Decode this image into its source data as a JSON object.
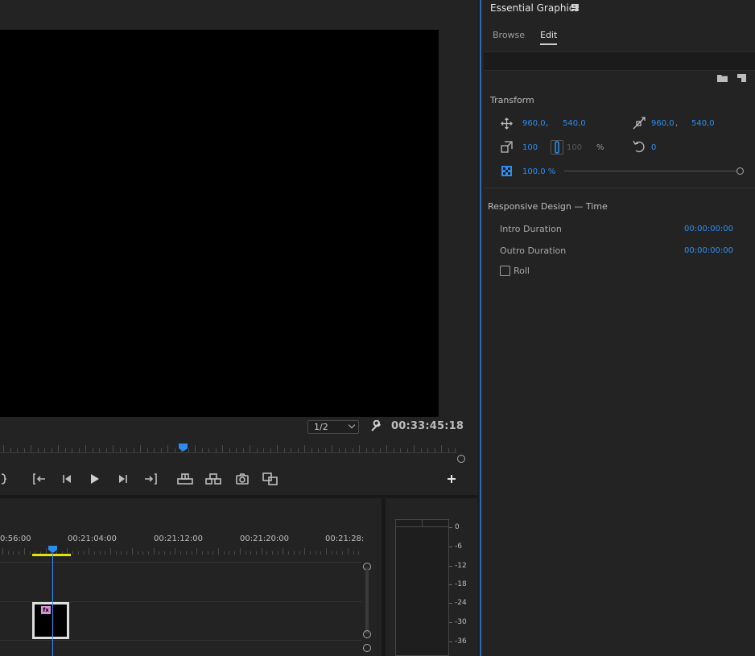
{
  "program_monitor": {
    "resolution": "1/2",
    "timecode": "00:33:45:18"
  },
  "timeline": {
    "ruler_labels": [
      "0:56:00",
      "00:21:04:00",
      "00:21:12:00",
      "00:21:20:00",
      "00:21:28:"
    ]
  },
  "audio_meter": {
    "db_labels": [
      "0",
      "-6",
      "-12",
      "-18",
      "-24",
      "-30",
      "-36"
    ]
  },
  "essential_graphics": {
    "title": "Essential Graphics",
    "tabs": [
      "Browse",
      "Edit"
    ],
    "active_tab": "Edit",
    "transform": {
      "title": "Transform",
      "position_x": "960,0",
      "position_y": "540,0",
      "anchor_x": "960,0",
      "anchor_y": "540,0",
      "scale": "100",
      "scale_height": "100",
      "scale_unit": "%",
      "rotation": "0",
      "opacity": "100,0 %",
      "separator": ","
    },
    "responsive_design": {
      "title": "Responsive Design — Time",
      "intro_label": "Intro Duration",
      "intro_value": "00:00:00:00",
      "outro_label": "Outro Duration",
      "outro_value": "00:00:00:00",
      "roll_label": "Roll",
      "roll_checked": false
    }
  },
  "colors": {
    "accent_blue": "#2e8ef0",
    "playhead": "#2d8ceb",
    "work_area": "#e5e500",
    "clip_fx": "#d98fd4"
  }
}
